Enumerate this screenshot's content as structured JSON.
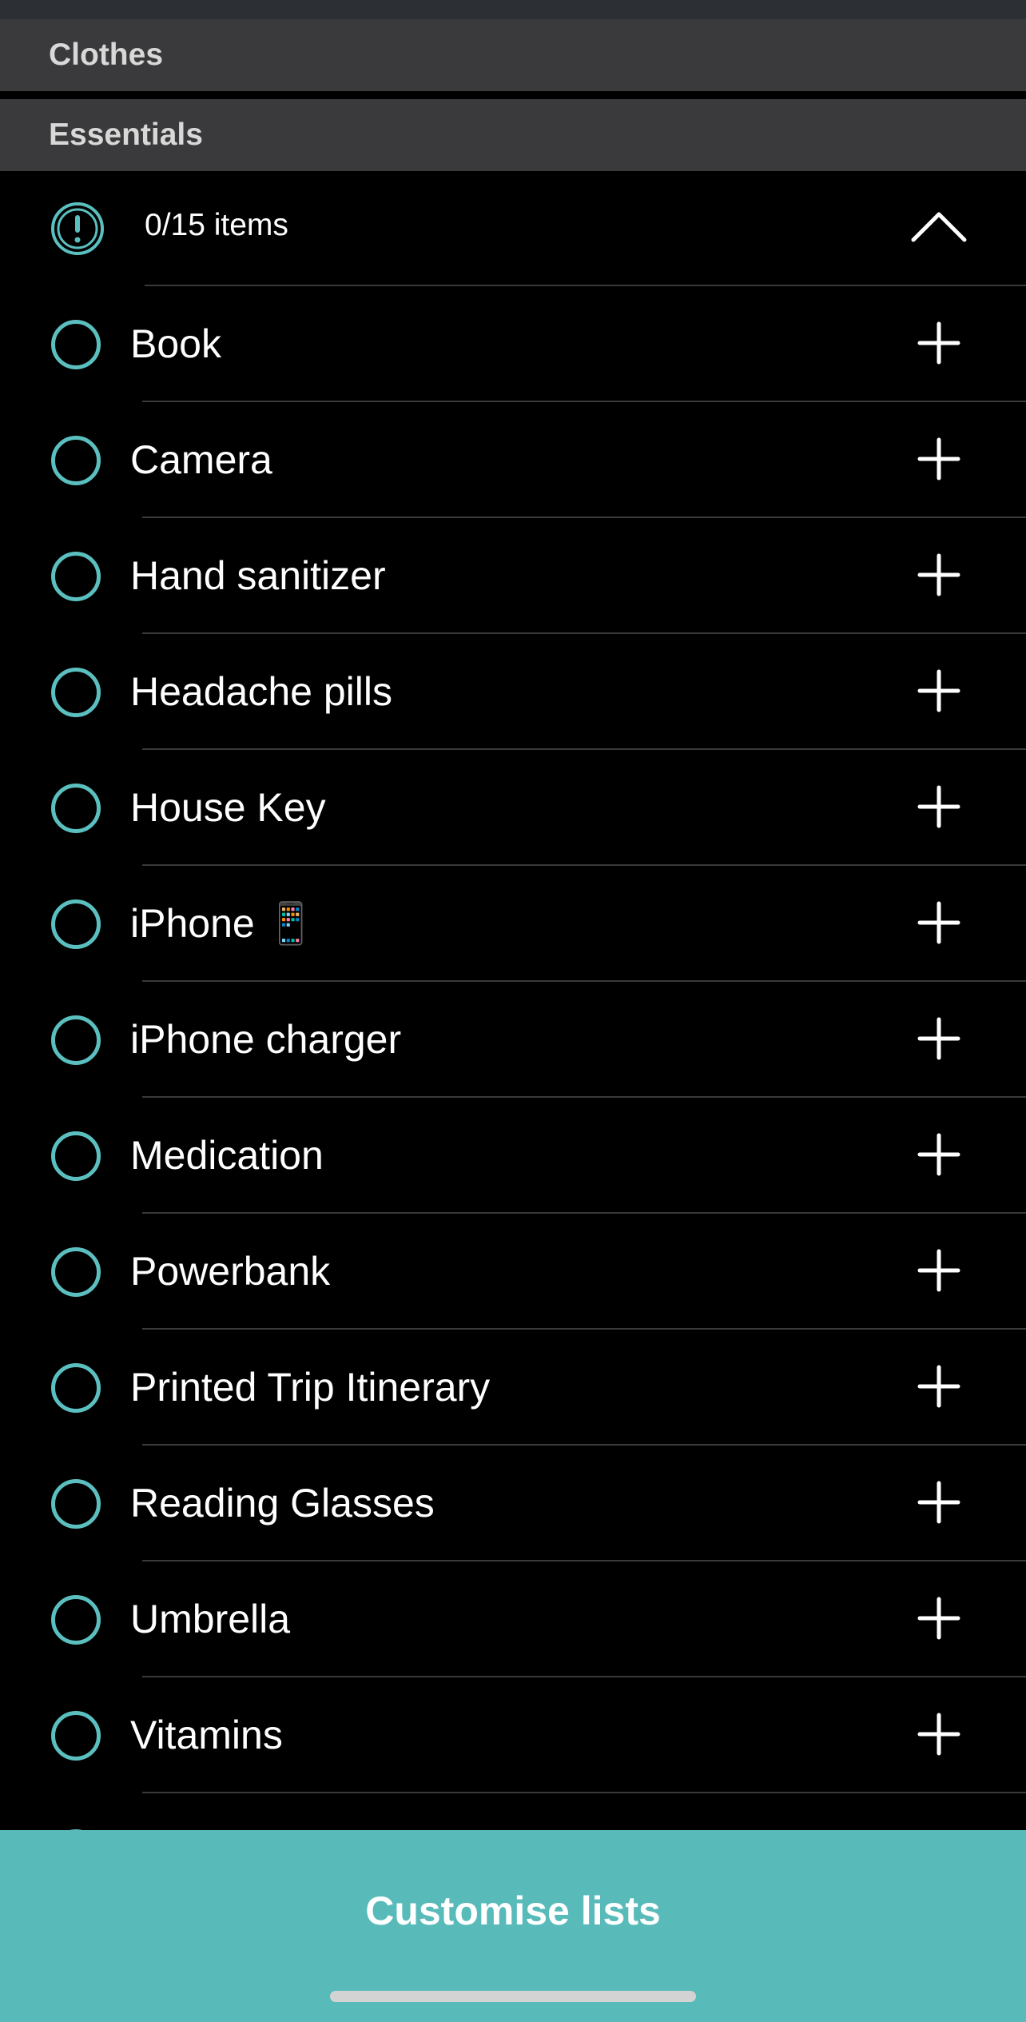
{
  "sections": {
    "clothes": {
      "title": "Clothes"
    },
    "essentials": {
      "title": "Essentials"
    }
  },
  "summary": {
    "icon": "exclamation-circle-icon",
    "count_text": "0/15 items",
    "collapse_icon": "chevron-up-icon"
  },
  "items": [
    {
      "label": "Book"
    },
    {
      "label": "Camera"
    },
    {
      "label": "Hand sanitizer"
    },
    {
      "label": "Headache pills"
    },
    {
      "label": "House Key"
    },
    {
      "label": "iPhone 📱"
    },
    {
      "label": "iPhone charger"
    },
    {
      "label": "Medication"
    },
    {
      "label": "Powerbank"
    },
    {
      "label": "Printed Trip Itinerary"
    },
    {
      "label": "Reading Glasses"
    },
    {
      "label": "Umbrella"
    },
    {
      "label": "Vitamins"
    }
  ],
  "footer": {
    "button_label": "Customise lists"
  },
  "colors": {
    "accent": "#5bbfbf",
    "footer_bg": "#59baba",
    "header_bg": "#3a3a3c",
    "background": "#000000"
  }
}
